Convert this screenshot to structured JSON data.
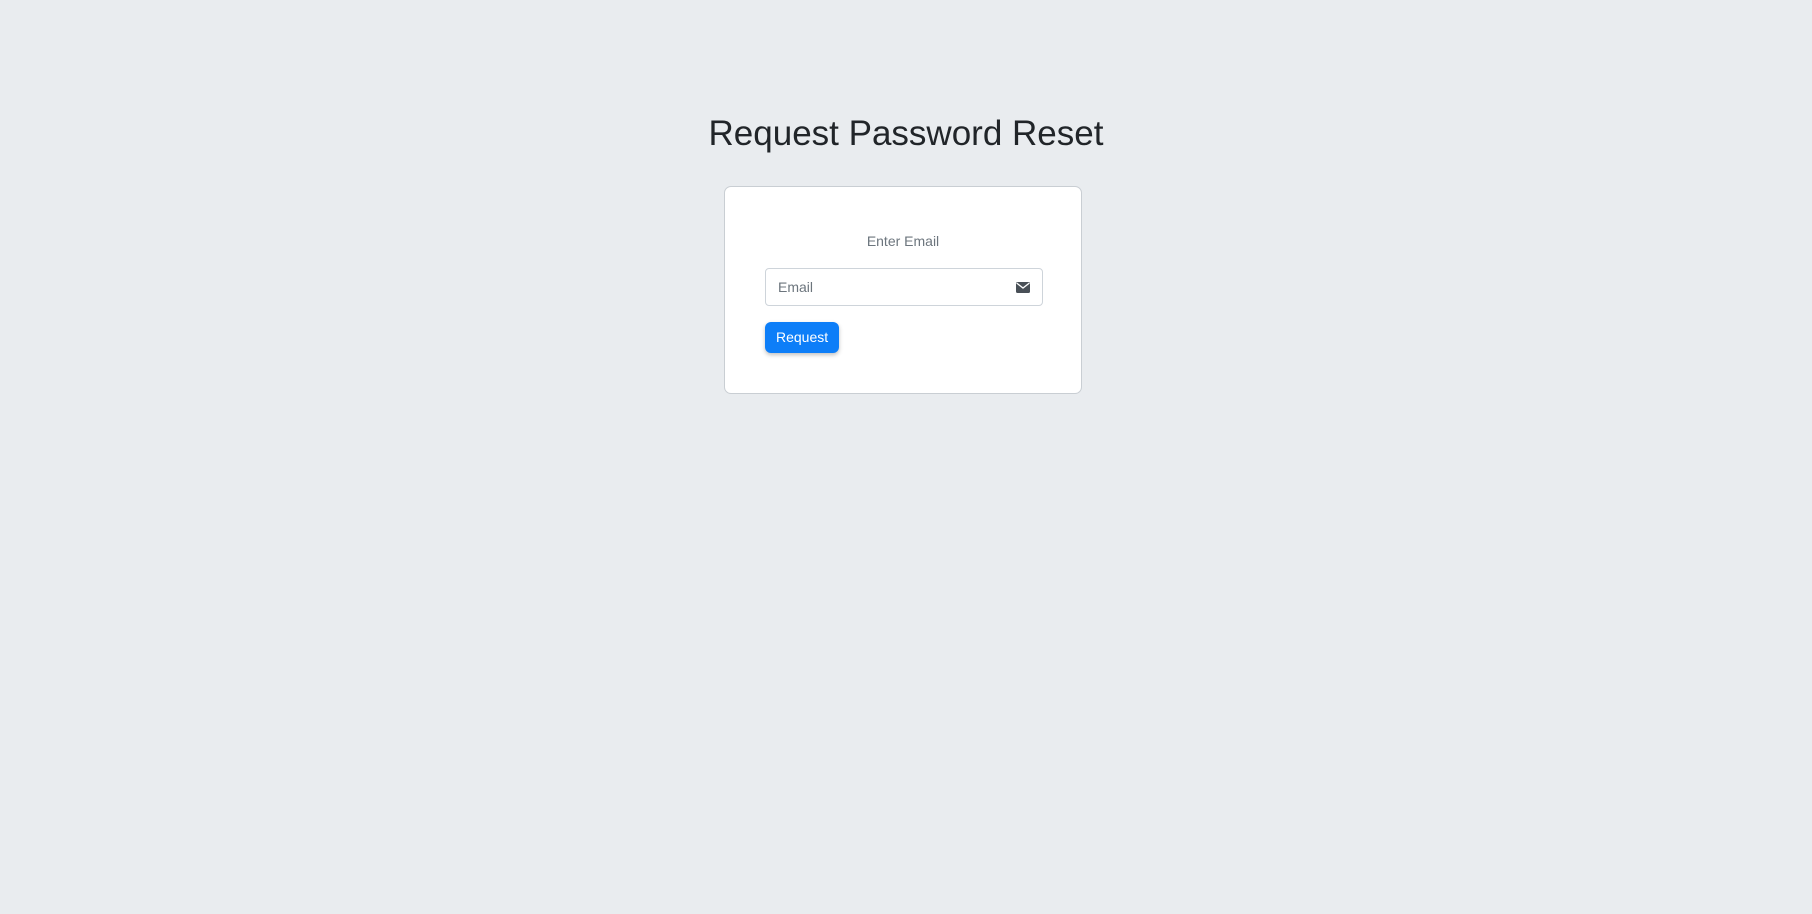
{
  "page": {
    "title": "Request Password Reset"
  },
  "form": {
    "message": "Enter Email",
    "email": {
      "value": "",
      "placeholder": "Email",
      "icon": "envelope-icon"
    },
    "submit_label": "Request"
  },
  "colors": {
    "background": "#e9ecef",
    "card": "#ffffff",
    "accent": "#0d7ef8",
    "muted_text": "#6c757d"
  }
}
